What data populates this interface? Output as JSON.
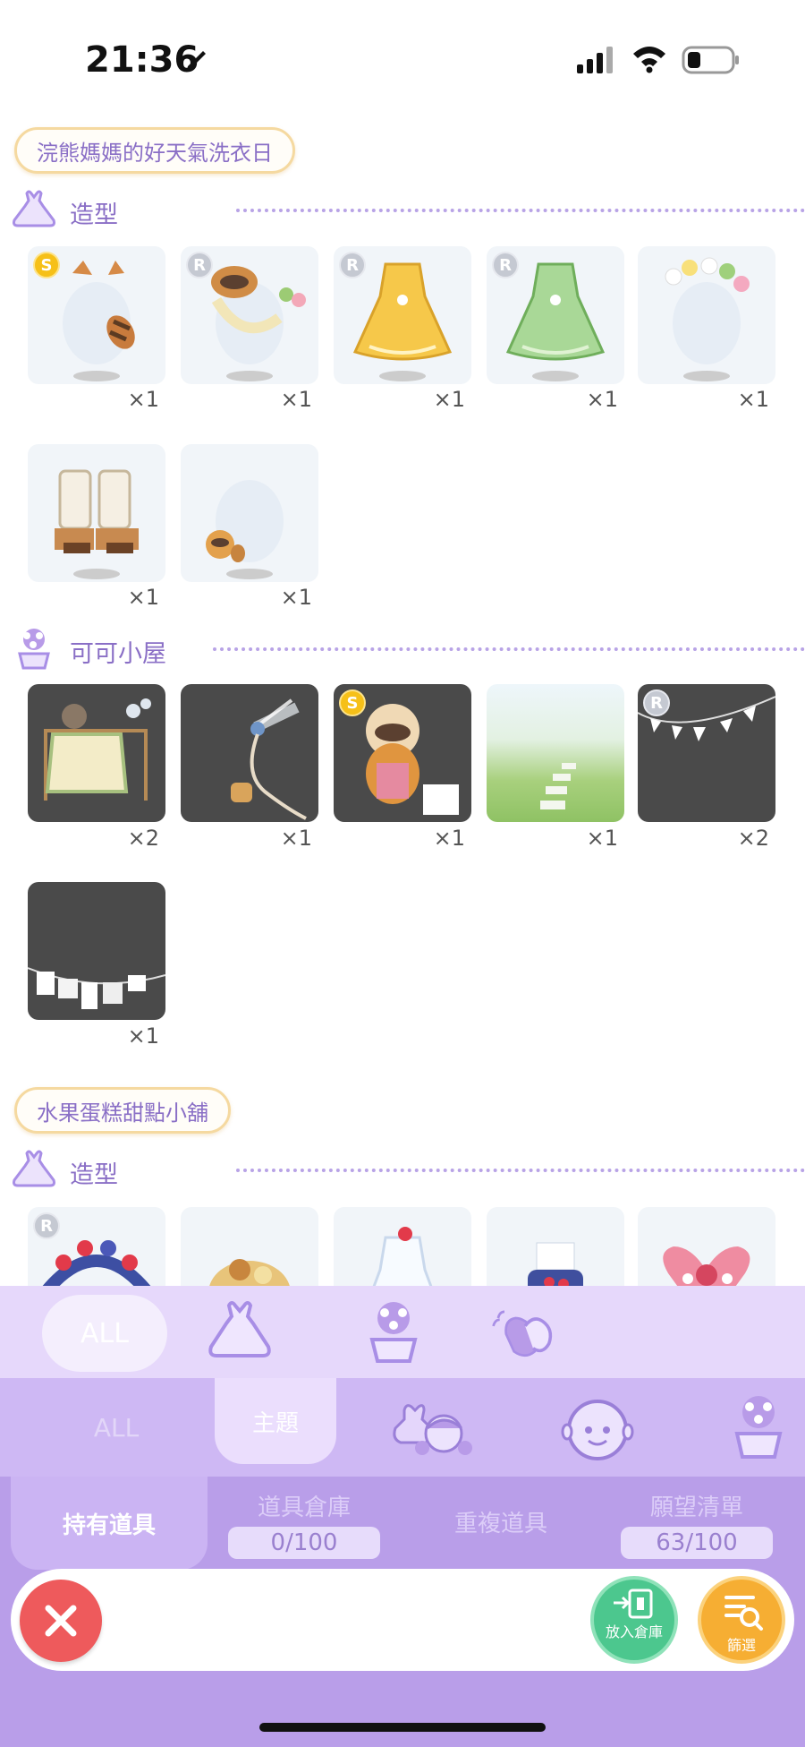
{
  "status": {
    "time": "21:36"
  },
  "themes": [
    {
      "title": "浣熊媽媽的好天氣洗衣日",
      "sections": [
        {
          "label": "造型",
          "icon": "dress-icon",
          "items": [
            {
              "badge": "S",
              "qty": "×1",
              "art": "raccoon-ears-tail"
            },
            {
              "badge": "R",
              "qty": "×1",
              "art": "raccoon-mask-lei"
            },
            {
              "badge": "R",
              "qty": "×1",
              "art": "yellow-dress"
            },
            {
              "badge": "R",
              "qty": "×1",
              "art": "green-dress"
            },
            {
              "badge": "",
              "qty": "×1",
              "art": "flower-crown"
            },
            {
              "badge": "",
              "qty": "×1",
              "art": "raccoon-boots"
            },
            {
              "badge": "",
              "qty": "×1",
              "art": "raccoon-plush"
            }
          ]
        },
        {
          "label": "可可小屋",
          "icon": "flower-pot-icon",
          "items": [
            {
              "badge": "",
              "qty": "×2",
              "art": "laundry-rack"
            },
            {
              "badge": "",
              "qty": "×1",
              "art": "water-hose"
            },
            {
              "badge": "S",
              "qty": "×1",
              "art": "raccoon-washboard"
            },
            {
              "badge": "",
              "qty": "×1",
              "art": "grass-path"
            },
            {
              "badge": "R",
              "qty": "×2",
              "art": "bunting"
            },
            {
              "badge": "",
              "qty": "×1",
              "art": "clothesline"
            }
          ]
        }
      ]
    },
    {
      "title": "水果蛋糕甜點小舖",
      "sections": [
        {
          "label": "造型",
          "icon": "dress-icon",
          "items": [
            {
              "badge": "R",
              "qty": "",
              "art": "berry-headband"
            },
            {
              "badge": "",
              "qty": "",
              "art": "cookie-hat"
            },
            {
              "badge": "",
              "qty": "",
              "art": "fruit-dress"
            },
            {
              "badge": "",
              "qty": "",
              "art": "berry-bag"
            },
            {
              "badge": "",
              "qty": "",
              "art": "pink-bow"
            }
          ]
        }
      ]
    }
  ],
  "filter_row1": {
    "all_label": "ALL",
    "icons": [
      "dress-icon",
      "flower-pot-icon",
      "wave-hand-icon"
    ]
  },
  "filter_row2": {
    "all_label": "ALL",
    "theme_label": "主題",
    "icons": [
      "couple-icon",
      "face-icon",
      "flower-pot-icon"
    ]
  },
  "tabs": {
    "owned": "持有道具",
    "storage": {
      "label": "道具倉庫",
      "count": "0/100"
    },
    "duplicate": {
      "label": "重複道具"
    },
    "wishlist": {
      "label": "願望清單",
      "count": "63/100"
    }
  },
  "actions": {
    "storage_btn": "放入倉庫",
    "filter_btn": "篩選"
  },
  "colors": {
    "accent": "#8a6fc6",
    "panel": "#b99ee9",
    "close": "#ee5a5c",
    "storage": "#4cc78e",
    "filter": "#f6ae33"
  }
}
